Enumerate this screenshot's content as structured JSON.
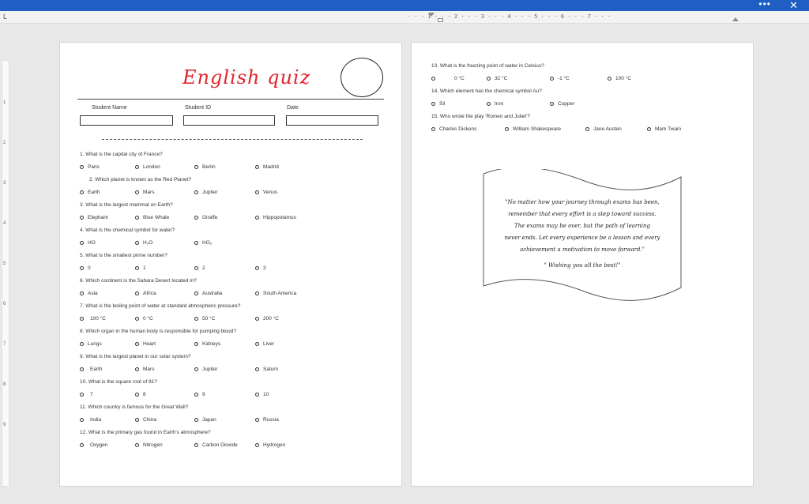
{
  "window": {
    "more_label": "•••",
    "close_label": "✕"
  },
  "ruler": {
    "tab_marker": "L",
    "horizontal_marks": "· · · 1 · · · 2 · · · 3 · · · 4 · · · 5 · · · 6 · · · 7 · · ·",
    "vertical_numbers": [
      "1",
      "2",
      "3",
      "4",
      "5",
      "6",
      "7",
      "8",
      "9"
    ]
  },
  "quiz": {
    "title": "English quiz",
    "title_color": "#e0242b",
    "fields": [
      {
        "label": "Student Name"
      },
      {
        "label": "Student ID"
      },
      {
        "label": "Date"
      }
    ],
    "questions": [
      {
        "text": "1.   What is the capital city of France?",
        "options": [
          "Paris",
          "London",
          "Berlin",
          "Madrid"
        ]
      },
      {
        "text": "2.   Which planet is known as the Red Planet?",
        "options": [
          "Earth",
          "Mars",
          "Jupiter",
          "Venus"
        ]
      },
      {
        "text": "3.   What is the largest mammal on Earth?",
        "options": [
          "Elephant",
          "Blue Whale",
          "Giraffe",
          "Hippopotamus"
        ]
      },
      {
        "text": "4.   What is the chemical symbol for water?",
        "options": [
          "HO",
          "H₂O",
          "HO₂",
          ""
        ]
      },
      {
        "text": "5.   What is the smallest prime number?",
        "options": [
          "0",
          "1",
          "2",
          "3"
        ]
      },
      {
        "text": "6.   Which continent is the Sahara Desert located in?",
        "options": [
          "Asia",
          "Africa",
          "Australia",
          "South America"
        ]
      },
      {
        "text": "7.   What is the boiling point of water at standard atmospheric pressure?",
        "options": [
          "100 °C",
          "0 °C",
          "50 °C",
          "200 °C"
        ]
      },
      {
        "text": "8.   Which organ in the human body is responsible for pumping blood?",
        "options": [
          "Lungs",
          "Heart",
          "Kidneys",
          "Liver"
        ]
      },
      {
        "text": "9.   What is the largest planet in our solar system?",
        "options": [
          "Earth",
          "Mars",
          "Jupiter",
          "Saturn"
        ]
      },
      {
        "text": "10.  What is the square root of 81?",
        "options": [
          "7",
          "8",
          "9",
          "10"
        ]
      },
      {
        "text": "11.  Which country is famous for the Great Wall?",
        "options": [
          "India",
          "China",
          "Japan",
          "Russia"
        ]
      },
      {
        "text": "12.  What is the primary gas found in Earth's atmosphere?",
        "options": [
          "Oxygen",
          "Nitrogen",
          "Carbon Dioxide",
          "Hydrogen"
        ]
      },
      {
        "text": "13.  What is the freezing point of water in Celsius?",
        "options": [
          "0 °C",
          "32 °C",
          "-1 °C",
          "100 °C"
        ]
      },
      {
        "text": "14.  Which element has the chemical symbol Au?",
        "options": [
          "Sil",
          "Iron",
          "Copper",
          ""
        ]
      },
      {
        "text": "15.  Who wrote the play 'Romeo and Juliet'?",
        "options": [
          "Charles Dickens",
          "William Shakespeare",
          "Jane Austen",
          "Mark Twain"
        ]
      }
    ],
    "quote_lines": [
      "\"No matter how your journey through exams has been,",
      "remember that every effort is a step toward success.",
      "The exams may be over, but the path of learning",
      "never ends. Let every experience be a lesson and every",
      "achievement a motivation to move forward.\"",
      "\" Wishing you all the best!\""
    ]
  }
}
